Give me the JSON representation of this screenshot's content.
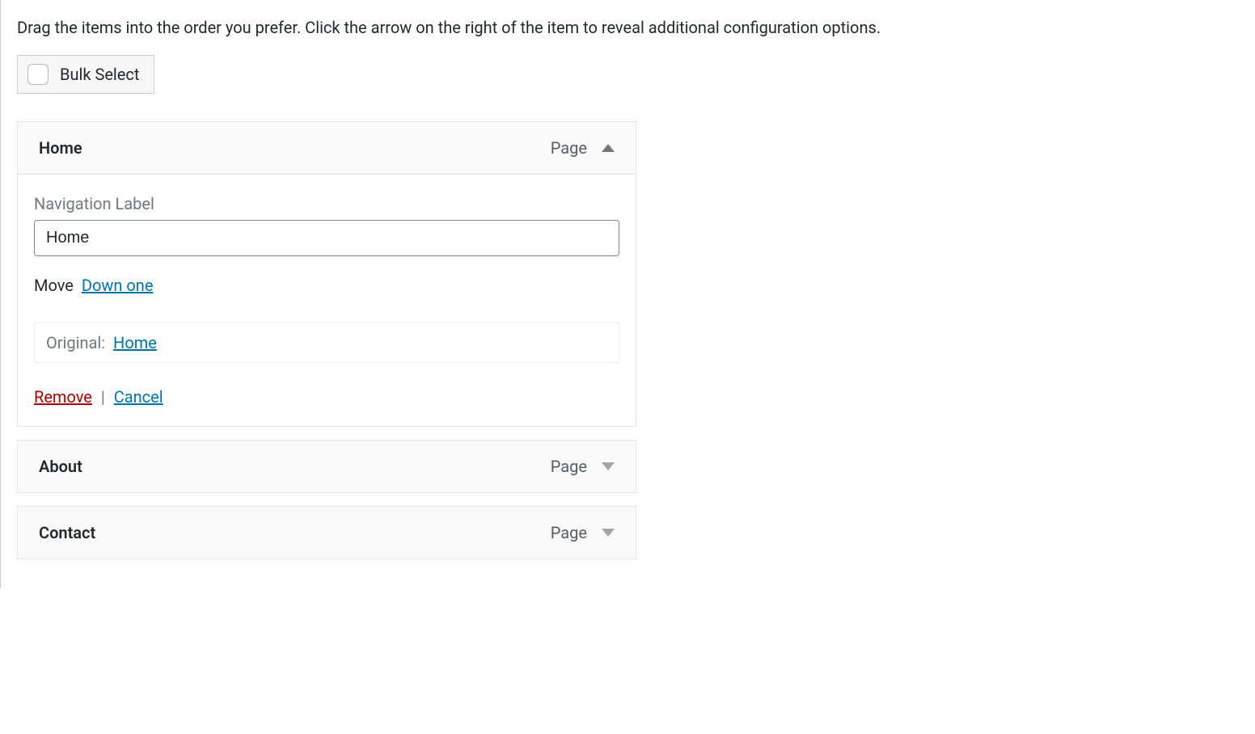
{
  "instructions": "Drag the items into the order you prefer. Click the arrow on the right of the item to reveal additional configuration options.",
  "bulkSelect": {
    "label": "Bulk Select"
  },
  "menuItems": [
    {
      "title": "Home",
      "type": "Page",
      "expanded": true,
      "navigationLabelTitle": "Navigation Label",
      "navigationLabelValue": "Home",
      "moveLabel": "Move",
      "moveDownLabel": "Down one",
      "originalPrefix": "Original:",
      "originalLink": "Home",
      "removeLabel": "Remove",
      "cancelLabel": "Cancel"
    },
    {
      "title": "About",
      "type": "Page",
      "expanded": false
    },
    {
      "title": "Contact",
      "type": "Page",
      "expanded": false
    }
  ]
}
